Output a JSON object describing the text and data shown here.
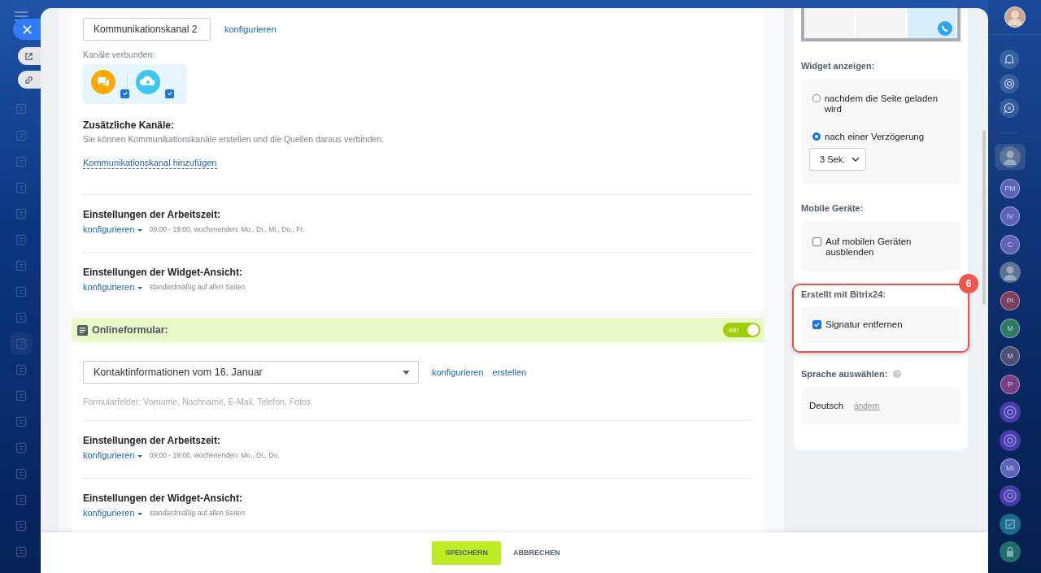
{
  "channel_section": {
    "channel_select": "Kommunikationskanal 2",
    "configure_link": "konfigurieren",
    "connected_label": "Kanäle verbunden:",
    "connected_channels": [
      {
        "kind": "chat",
        "checked": true,
        "color": "#ffa900"
      },
      {
        "kind": "cloud",
        "checked": true,
        "color": "#3bc8f5"
      }
    ],
    "additional_title": "Zusätzliche Kanäle:",
    "additional_description": "Sie können Kommunikationskanäle erstellen und die Quellen daraus verbinden.",
    "add_link": "Kommunikationskanal hinzufügen",
    "settings": [
      {
        "title": "Einstellungen der Arbeitszeit:",
        "link": "konfigurieren",
        "summary": "09:00 - 19:00, wochenenden: Mo., Di., Mi., Do., Fr."
      },
      {
        "title": "Einstellungen der Widget-Ansicht:",
        "link": "konfigurieren",
        "summary": "standardmäßig auf allen Seiten"
      }
    ]
  },
  "online_form": {
    "title": "Onlineformular:",
    "toggle": {
      "label": "ein",
      "on": true
    },
    "form_select": "Kontaktinformationen vom 16. Januar",
    "links": [
      "konfigurieren",
      "erstellen"
    ],
    "fields_note": "Formularfelder: Vorname, Nachname, E-Mail, Telefon, Fotos",
    "settings": [
      {
        "title": "Einstellungen der Arbeitszeit:",
        "link": "konfigurieren",
        "summary": "09:00 - 19:00, wochenenden: Mo., Di., Do."
      },
      {
        "title": "Einstellungen der Widget-Ansicht:",
        "link": "konfigurieren",
        "summary": "standardmäßig auf allen Seiten"
      }
    ]
  },
  "side_panel": {
    "show_widget": {
      "title": "Widget anzeigen:",
      "options": [
        {
          "label": "nachdem die Seite geladen wird",
          "selected": false
        },
        {
          "label": "nach einer Verzögerung",
          "selected": true
        }
      ],
      "delay": "3 Sek."
    },
    "mobile": {
      "title": "Mobile Geräte:",
      "option": {
        "label": "Auf mobilen Geräten ausblenden",
        "checked": false
      }
    },
    "branding": {
      "title": "Erstellt mit Bitrix24:",
      "option": {
        "label": "Signatur entfernen",
        "checked": true
      },
      "badge": "6"
    },
    "language": {
      "title": "Sprache auswählen:",
      "value": "Deutsch",
      "change_link": "ändern"
    }
  },
  "footer": {
    "buttons": [
      {
        "label": "SPEICHERN",
        "kind": "primary"
      },
      {
        "label": "ABBRECHEN",
        "kind": "secondary"
      }
    ]
  },
  "right_rail": [
    {
      "kind": "photo",
      "selected": true
    },
    {
      "kind": "initials",
      "initials": "PM",
      "selected": false,
      "color": "#5f63b8"
    },
    {
      "kind": "initials",
      "initials": "IV",
      "selected": false,
      "color": "#5f63b8"
    },
    {
      "kind": "initials",
      "initials": "C",
      "selected": false,
      "color": "#5f63b8"
    },
    {
      "kind": "photo",
      "selected": false
    },
    {
      "kind": "initials",
      "initials": "PI",
      "selected": false,
      "color": "#7c3f5c"
    },
    {
      "kind": "initials",
      "initials": "M",
      "selected": false,
      "color": "#2c7a62"
    },
    {
      "kind": "initials",
      "initials": "M",
      "selected": false,
      "color": "#4f4f72"
    },
    {
      "kind": "initials",
      "initials": "P",
      "selected": false,
      "color": "#7a3f80"
    },
    {
      "kind": "channel",
      "selected": false
    },
    {
      "kind": "channel",
      "selected": false
    },
    {
      "kind": "initials",
      "initials": "MI",
      "selected": false,
      "color": "#5f63b8"
    },
    {
      "kind": "channel",
      "selected": false
    },
    {
      "kind": "task",
      "selected": false
    },
    {
      "kind": "lock",
      "selected": false
    }
  ]
}
